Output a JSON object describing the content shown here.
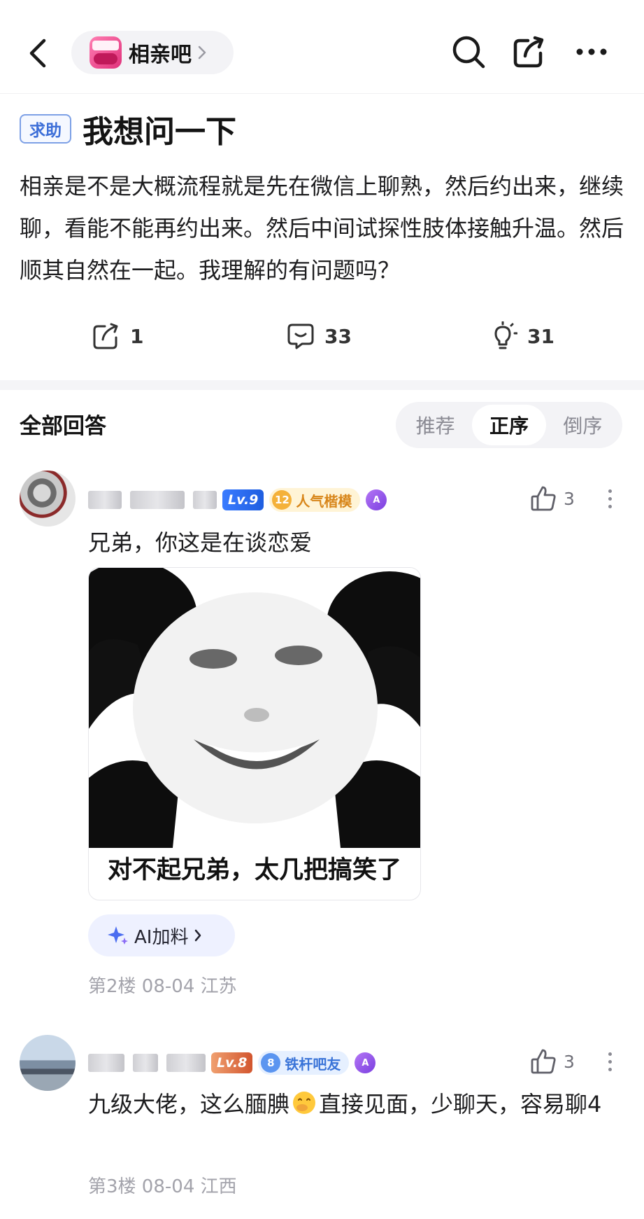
{
  "header": {
    "forum_name": "相亲吧"
  },
  "post": {
    "tag": "求助",
    "title": "我想问一下",
    "body": "相亲是不是大概流程就是先在微信上聊熟，然后约出来，继续聊，看能不能再约出来。然后中间试探性肢体接触升温。然后顺其自然在一起。我理解的有问题吗？",
    "share_count": "1",
    "comment_count": "33",
    "idea_count": "31"
  },
  "answers": {
    "title": "全部回答",
    "sort_options": [
      "推荐",
      "正序",
      "倒序"
    ],
    "active_sort": "正序"
  },
  "replies": [
    {
      "level_badge": "Lv.9",
      "title_level": "12",
      "title_badge": "人气楷模",
      "likes": "3",
      "text": "兄弟，你这是在谈恋爱",
      "meme_caption": "对不起兄弟，太几把搞笑了",
      "ai_chip": "AI加料",
      "meta": "第2楼 08-04 江苏"
    },
    {
      "level_badge": "Lv.8",
      "title_level": "8",
      "title_badge": "铁杆吧友",
      "likes": "3",
      "text_before": "九级大佬，这么腼腆",
      "text_after": "直接见面，少聊天，容易聊4",
      "meta": "第3楼 08-04 江西"
    }
  ],
  "colors": {
    "accent_blue": "#3d6fd8",
    "gold_badge": "#f4b13a",
    "meta_gray": "#a3a3ab"
  },
  "icons": [
    "back-arrow-icon",
    "search-icon",
    "share-icon",
    "more-icon",
    "comment-icon",
    "lightbulb-icon",
    "thumbs-up-icon",
    "sparkle-icon",
    "chevron-right-icon",
    "emoji-face-icon"
  ]
}
